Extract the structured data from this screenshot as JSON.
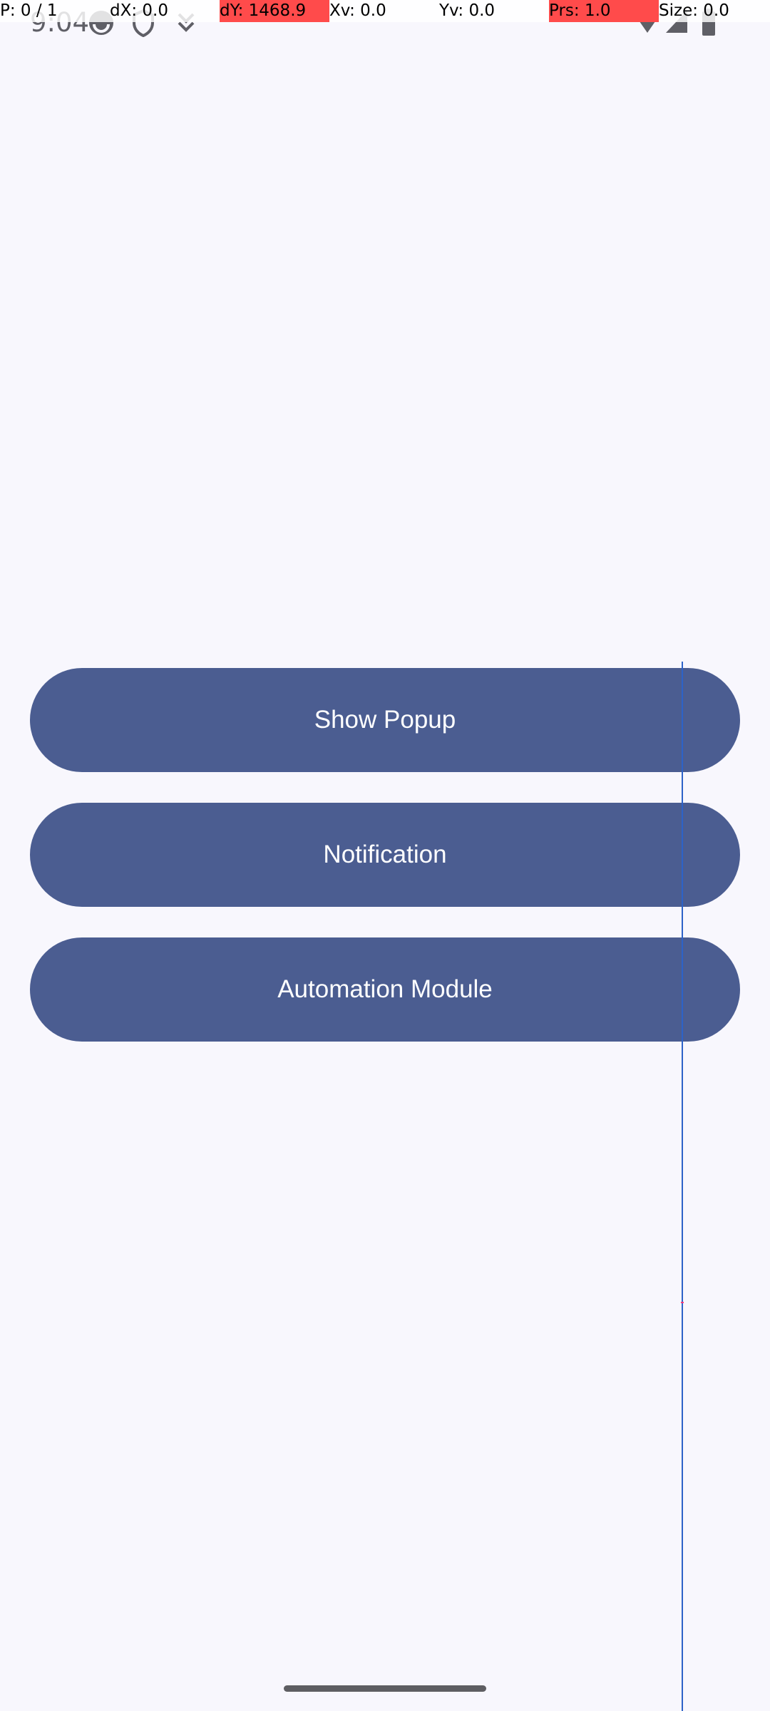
{
  "status_bar": {
    "time": "9:04",
    "icons": [
      "sync-icon",
      "vpn-icon",
      "download-icon",
      "wifi-icon",
      "signal-icon",
      "battery-icon"
    ]
  },
  "pointer_overlay": {
    "p": "P: 0 / 1",
    "dx": "dX: 0.0",
    "dy": "dY: 1468.9",
    "xv": "Xv: 0.0",
    "yv": "Yv: 0.0",
    "prs": "Prs: 1.0",
    "size": "Size: 0.0"
  },
  "main": {
    "buttons": [
      {
        "label": "Show Popup"
      },
      {
        "label": "Notification"
      },
      {
        "label": "Automation Module"
      }
    ]
  },
  "colors": {
    "background": "#f8f7fd",
    "button": "#4b5d91",
    "button_text": "#ffffff",
    "overlay_highlight": "#ff4b4b",
    "trace": "#2d63c8"
  }
}
